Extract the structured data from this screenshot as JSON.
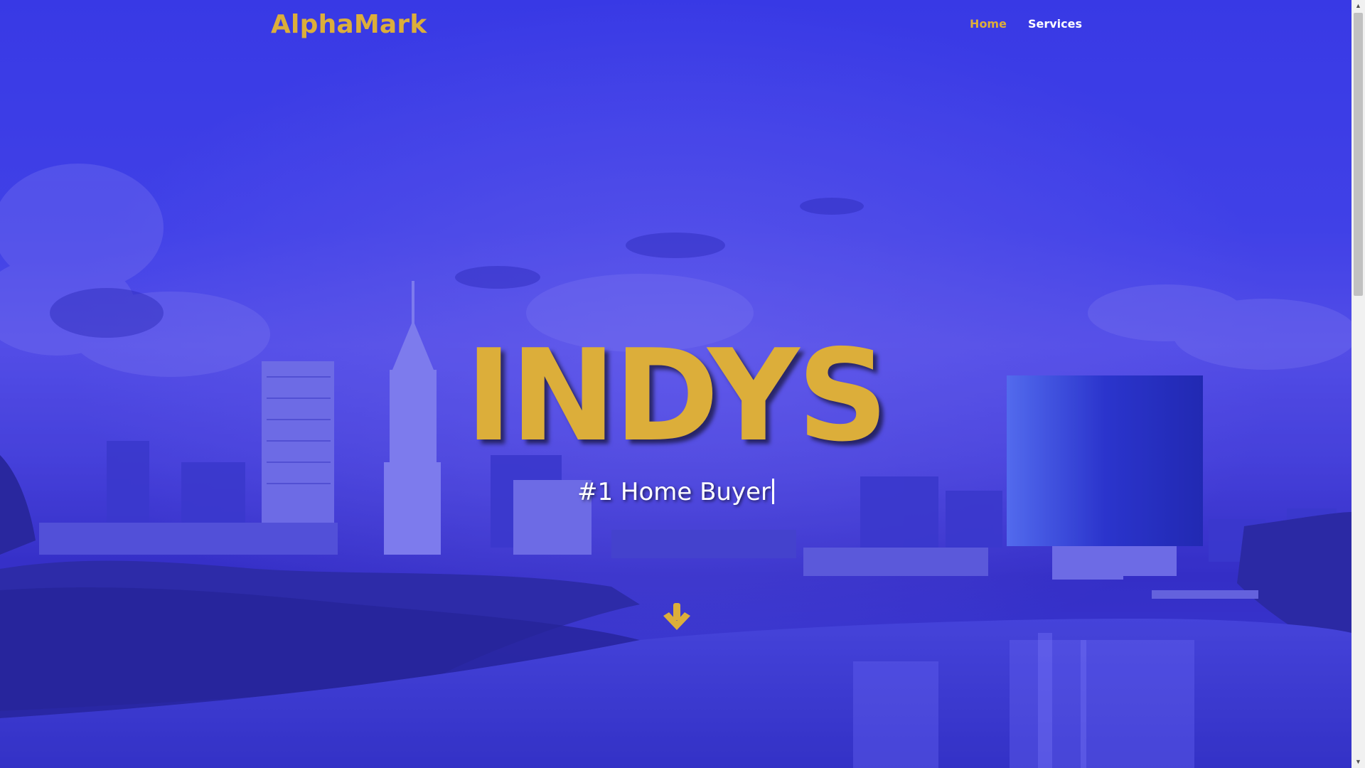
{
  "header": {
    "brand": "AlphaMark",
    "nav": [
      {
        "label": "Home",
        "active": true
      },
      {
        "label": "Services",
        "active": false
      }
    ]
  },
  "hero": {
    "title": "INDYS",
    "subtitle": "#1 Home Buyer",
    "scroll_icon": "arrow-down-icon"
  },
  "colors": {
    "accent": "#dcae3a",
    "overlay": "#3a3ee6",
    "text": "#ffffff"
  }
}
